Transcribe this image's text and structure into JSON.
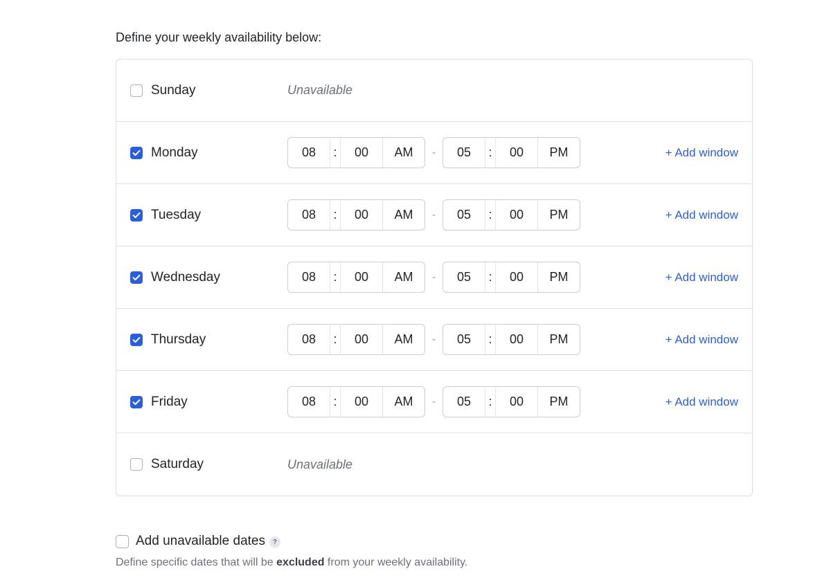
{
  "heading": "Define your weekly availability below:",
  "days": [
    {
      "name": "Sunday",
      "enabled": false,
      "status": "Unavailable"
    },
    {
      "name": "Monday",
      "enabled": true,
      "start": {
        "hh": "08",
        "mm": "00",
        "ap": "AM"
      },
      "end": {
        "hh": "05",
        "mm": "00",
        "ap": "PM"
      }
    },
    {
      "name": "Tuesday",
      "enabled": true,
      "start": {
        "hh": "08",
        "mm": "00",
        "ap": "AM"
      },
      "end": {
        "hh": "05",
        "mm": "00",
        "ap": "PM"
      }
    },
    {
      "name": "Wednesday",
      "enabled": true,
      "start": {
        "hh": "08",
        "mm": "00",
        "ap": "AM"
      },
      "end": {
        "hh": "05",
        "mm": "00",
        "ap": "PM"
      }
    },
    {
      "name": "Thursday",
      "enabled": true,
      "start": {
        "hh": "08",
        "mm": "00",
        "ap": "AM"
      },
      "end": {
        "hh": "05",
        "mm": "00",
        "ap": "PM"
      }
    },
    {
      "name": "Friday",
      "enabled": true,
      "start": {
        "hh": "08",
        "mm": "00",
        "ap": "AM"
      },
      "end": {
        "hh": "05",
        "mm": "00",
        "ap": "PM"
      }
    },
    {
      "name": "Saturday",
      "enabled": false,
      "status": "Unavailable"
    }
  ],
  "separators": {
    "colon": ":",
    "dash": "-"
  },
  "add_window_label": "+ Add window",
  "unavailable_dates": {
    "label": "Add unavailable dates",
    "help_icon": "question-mark-icon",
    "help_glyph": "?",
    "desc_before": "Define specific dates that will be ",
    "desc_bold": "excluded",
    "desc_after": " from your weekly availability."
  },
  "colors": {
    "accent": "#2b5fd9",
    "border": "#d9dde2",
    "muted_text": "#6a7079"
  }
}
